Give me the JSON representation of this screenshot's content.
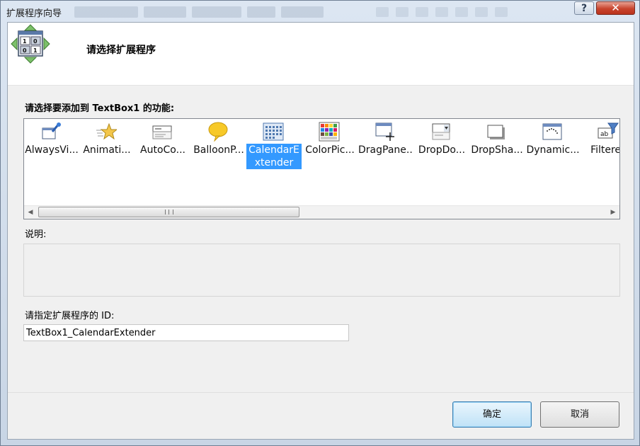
{
  "window": {
    "title": "扩展程序向导",
    "help_label": "?",
    "close_label": "✕"
  },
  "header": {
    "title": "请选择扩展程序"
  },
  "extenders": {
    "label": "请选择要添加到 TextBox1 的功能:",
    "items": [
      {
        "label": "AlwaysVi...",
        "icon": "pushpin-window-icon"
      },
      {
        "label": "Animati...",
        "icon": "animation-star-icon"
      },
      {
        "label": "AutoCo...",
        "icon": "autocomplete-textbox-icon"
      },
      {
        "label": "BalloonP...",
        "icon": "balloon-icon"
      },
      {
        "label": "CalendarExtender",
        "icon": "calendar-grid-icon",
        "selected": true
      },
      {
        "label": "ColorPic...",
        "icon": "color-palette-icon"
      },
      {
        "label": "DragPane...",
        "icon": "drag-panel-icon"
      },
      {
        "label": "DropDo...",
        "icon": "dropdown-icon"
      },
      {
        "label": "DropSha...",
        "icon": "drop-shadow-icon"
      },
      {
        "label": "Dynamic...",
        "icon": "dynamic-populate-icon"
      },
      {
        "label": "Filtered",
        "icon": "filter-textbox-icon"
      }
    ],
    "scroll_grip": "III"
  },
  "description": {
    "label": "说明:"
  },
  "id_field": {
    "label": "请指定扩展程序的 ID:",
    "value": "TextBox1_CalendarExtender"
  },
  "buttons": {
    "ok": "确定",
    "cancel": "取消"
  }
}
